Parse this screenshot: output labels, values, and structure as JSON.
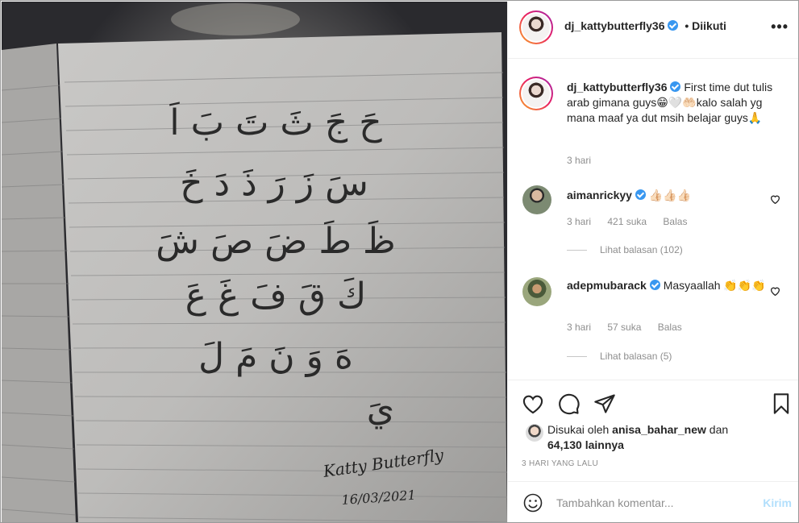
{
  "post": {
    "image_handwriting": {
      "row1": "حَ   جَ   ثَ   تَ   بَ   اَ",
      "row2": "سَ   زَ   رَ   ذَ   دَ   خَ",
      "row3": "ظَ   طَ   ضَ   صَ   شَ",
      "row4": "كَ   قَ   فَ   غَ   عَ",
      "row5": "هَ   وَ   نَ   مَ   لَ",
      "row6": "يَ",
      "signature": "Katty Butterfly",
      "date": "16/03/2021"
    }
  },
  "header": {
    "username": "dj_kattybutterfly36",
    "follow_status": "• Diikuti"
  },
  "caption": {
    "username": "dj_kattybutterfly36",
    "text": "First time dut tulis arab gimana guys😁🤍🤲🏻kalo salah yg mana maaf ya dut msih belajar guys🙏",
    "time": "3 hari"
  },
  "comments": [
    {
      "username": "aimanrickyy",
      "text": "👍🏻👍🏻👍🏻",
      "time": "3 hari",
      "likes": "421 suka",
      "reply": "Balas",
      "view_replies": "Lihat balasan (102)"
    },
    {
      "username": "adepmubarack",
      "text": "Masyaallah 👏👏👏",
      "time": "3 hari",
      "likes": "57 suka",
      "reply": "Balas",
      "view_replies": "Lihat balasan (5)"
    }
  ],
  "likes": {
    "prefix": "Disukai oleh",
    "user": "anisa_bahar_new",
    "connector": "dan",
    "count": "64,130 lainnya"
  },
  "date_posted": "3 HARI YANG LALU",
  "add_comment": {
    "placeholder": "Tambahkan komentar...",
    "post_label": "Kirim"
  },
  "colors": {
    "verified": "#3897f0",
    "post_disabled": "#b2dffc",
    "muted": "#8e8e8e"
  }
}
